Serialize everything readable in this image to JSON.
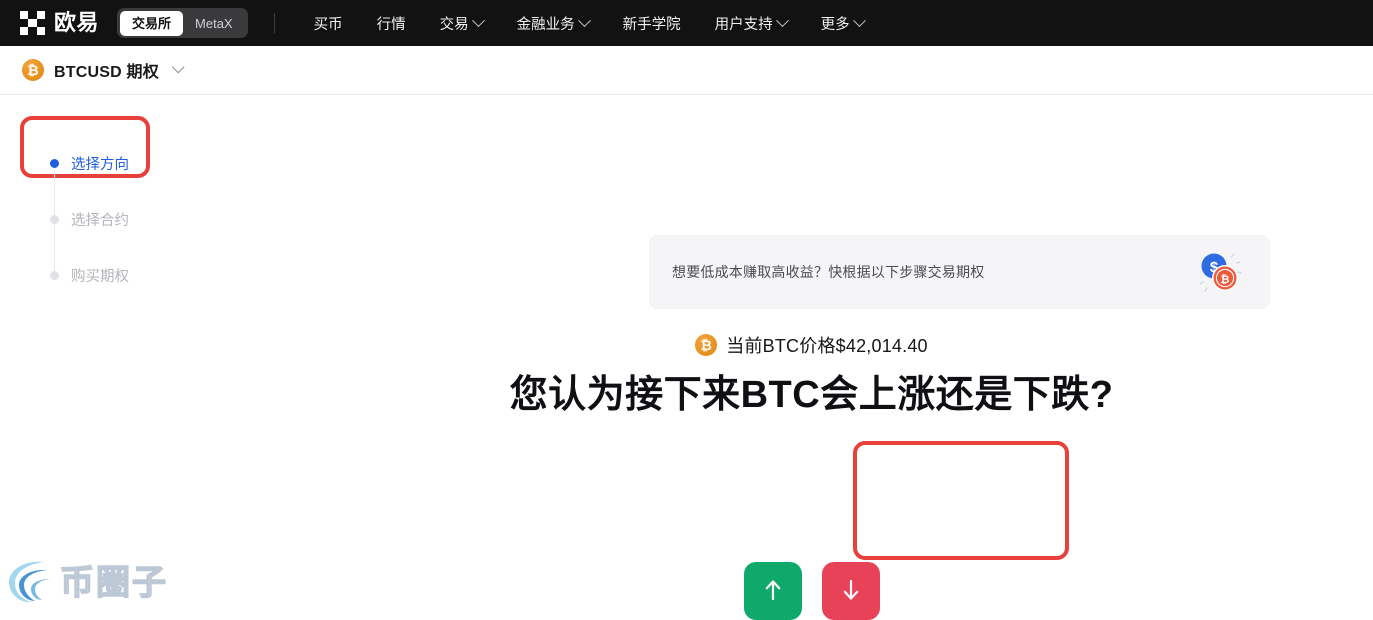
{
  "navbar": {
    "brand": "欧易",
    "brand_logo_icon": "okx-checker-logo-icon",
    "toggle": {
      "active": "交易所",
      "inactive": "MetaX"
    },
    "links": [
      {
        "label": "买币",
        "has_caret": false
      },
      {
        "label": "行情",
        "has_caret": false
      },
      {
        "label": "交易",
        "has_caret": true
      },
      {
        "label": "金融业务",
        "has_caret": true
      },
      {
        "label": "新手学院",
        "has_caret": false
      },
      {
        "label": "用户支持",
        "has_caret": true
      },
      {
        "label": "更多",
        "has_caret": true
      }
    ]
  },
  "ticker": {
    "coin_icon": "bitcoin-coin-icon",
    "coin_symbol": "₿",
    "name": "BTCUSD 期权",
    "caret_icon": "chevron-down-icon"
  },
  "steps": [
    {
      "label": "选择方向",
      "state": "active"
    },
    {
      "label": "选择合约",
      "state": "pending"
    },
    {
      "label": "购买期权",
      "state": "pending"
    }
  ],
  "promo": {
    "text": "想要低成本赚取高收益？快根据以下步骤交易期权",
    "art_icon": "two-coins-icon",
    "dollar_symbol": "$",
    "bitcoin_symbol": "₿"
  },
  "hero": {
    "coin_icon": "bitcoin-coin-icon",
    "coin_symbol": "₿",
    "price_text": "当前BTC价格$42,014.40",
    "headline": "您认为接下来BTC会上涨还是下跌?",
    "buttons": {
      "up": {
        "icon": "arrow-up-icon",
        "color": "#10a96c"
      },
      "down": {
        "icon": "arrow-down-icon",
        "color": "#e84258"
      }
    }
  },
  "annotations": {
    "color": "#e8413c",
    "boxes": [
      "选择方向",
      "direction-buttons"
    ]
  },
  "watermark": {
    "text": "币圈子",
    "logo_icon": "spiral-swirl-icon"
  },
  "colors": {
    "navbar_bg": "#121212",
    "accent_blue": "#1f5ee0",
    "up_green": "#10a96c",
    "down_red": "#e84258",
    "annotation_red": "#e8413c",
    "banner_bg": "#f5f5f7",
    "btc_orange": "#e8941f"
  }
}
